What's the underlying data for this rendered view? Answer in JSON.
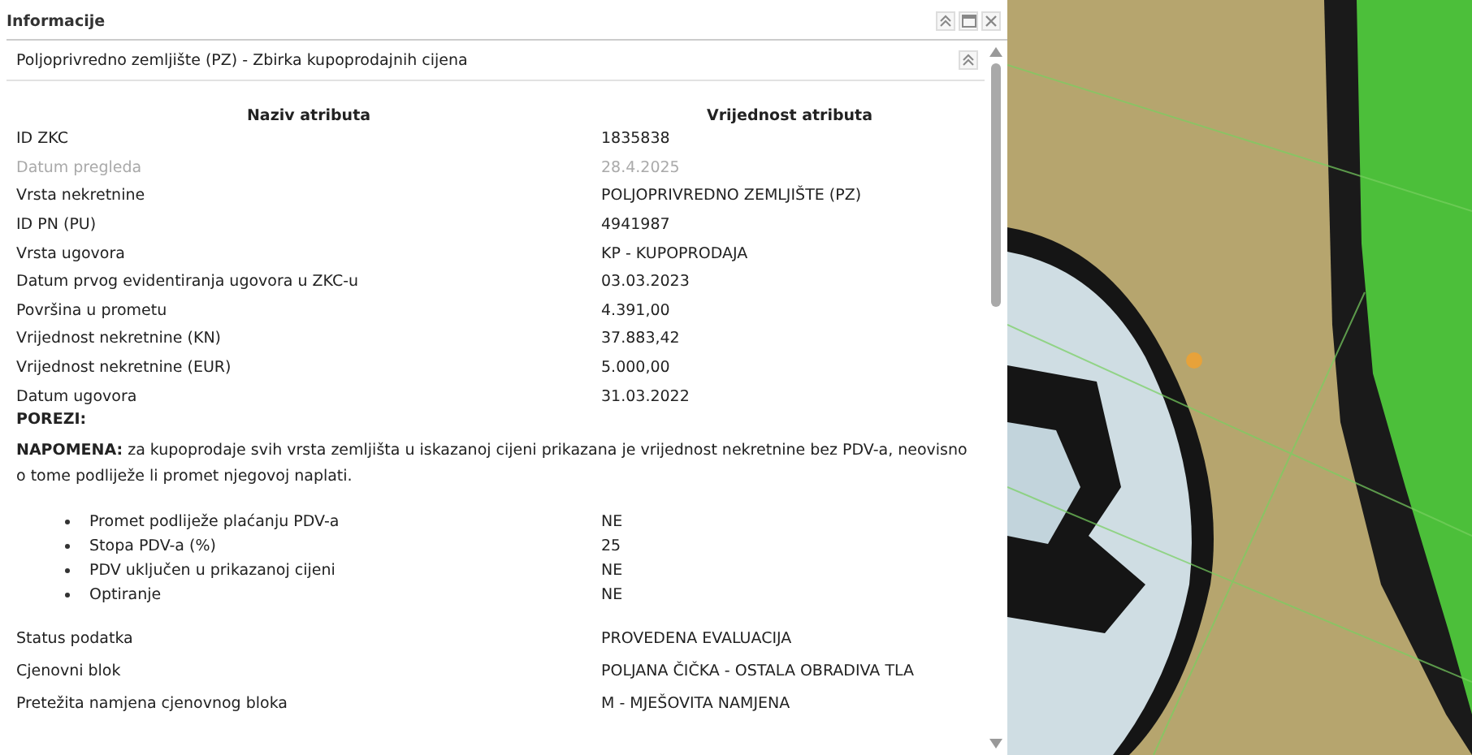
{
  "panel": {
    "title": "Informacije",
    "subtitle": "Poljoprivredno zemljište (PZ) - Zbirka kupoprodajnih cijena"
  },
  "table": {
    "columns": [
      "Naziv atributa",
      "Vrijednost atributa"
    ],
    "rows": [
      {
        "name": "ID ZKC",
        "value": "1835838",
        "disabled": false
      },
      {
        "name": "Datum pregleda",
        "value": "28.4.2025",
        "disabled": true
      },
      {
        "name": "Vrsta nekretnine",
        "value": "POLJOPRIVREDNO ZEMLJIŠTE (PZ)",
        "disabled": false
      },
      {
        "name": "ID PN (PU)",
        "value": "4941987",
        "disabled": false
      },
      {
        "name": "Vrsta ugovora",
        "value": "KP - KUPOPRODAJA",
        "disabled": false
      },
      {
        "name": "Datum prvog evidentiranja ugovora u ZKC-u",
        "value": "03.03.2023",
        "disabled": false
      },
      {
        "name": "Površina u prometu",
        "value": "4.391,00",
        "disabled": false
      },
      {
        "name": "Vrijednost nekretnine (KN)",
        "value": "37.883,42",
        "disabled": false
      },
      {
        "name": "Vrijednost nekretnine (EUR)",
        "value": "5.000,00",
        "disabled": false
      },
      {
        "name": "Datum ugovora",
        "value": "31.03.2022",
        "disabled": false
      }
    ]
  },
  "taxes": {
    "heading": "POREZI:",
    "note": "**NAPOMENA:** za kupoprodaje svih vrsta zemljišta u iskazanoj cijeni prikazana je vrijednost nekretnine bez PDV-a, neovisno o tome podliježe li promet njegovoj naplati.",
    "items": [
      {
        "name": "Promet podliježe plaćanju PDV-a",
        "value": "NE"
      },
      {
        "name": "Stopa PDV-a (%)",
        "value": "25"
      },
      {
        "name": "PDV uključen u prikazanoj cijeni",
        "value": "NE"
      },
      {
        "name": "Optiranje",
        "value": "NE"
      }
    ]
  },
  "status_rows": [
    {
      "name": "Status podatka",
      "value": "PROVEDENA EVALUACIJA"
    },
    {
      "name": "Cjenovni blok",
      "value": "POLJANA ČIČKA - OSTALA OBRADIVA TLA"
    },
    {
      "name": "Pretežita namjena cjenovnog bloka",
      "value": "M - MJEŠOVITA NAMJENA"
    }
  ]
}
